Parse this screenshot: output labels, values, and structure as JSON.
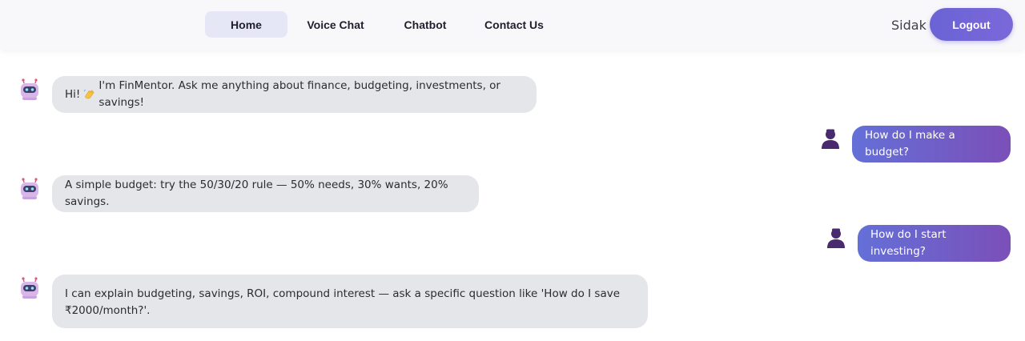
{
  "nav": {
    "links": [
      "Home",
      "Voice Chat",
      "Chatbot",
      "Contact Us"
    ],
    "active": "Home",
    "username": "Sidak",
    "logout_label": "Logout"
  },
  "messages": [
    {
      "role": "bot",
      "text_before": "Hi! ",
      "emoji": "waving-hand-icon",
      "text_after": " I'm FinMentor. Ask me anything about finance, budgeting, investments, or savings!"
    },
    {
      "role": "user",
      "text": "How do I make a budget?"
    },
    {
      "role": "bot",
      "text": "A simple budget: try the 50/30/20 rule — 50% needs, 30% wants, 20% savings."
    },
    {
      "role": "user",
      "text": "How do I start investing?"
    },
    {
      "role": "bot",
      "text": "I can explain budgeting, savings, ROI, compound interest — ask a specific question like 'How do I save ₹2000/month?'."
    }
  ],
  "colors": {
    "accent": "#6a63d6",
    "bot_bubble": "#e5e6ea",
    "user_bubble_start": "#6470d8",
    "user_bubble_end": "#7b4fb8"
  }
}
